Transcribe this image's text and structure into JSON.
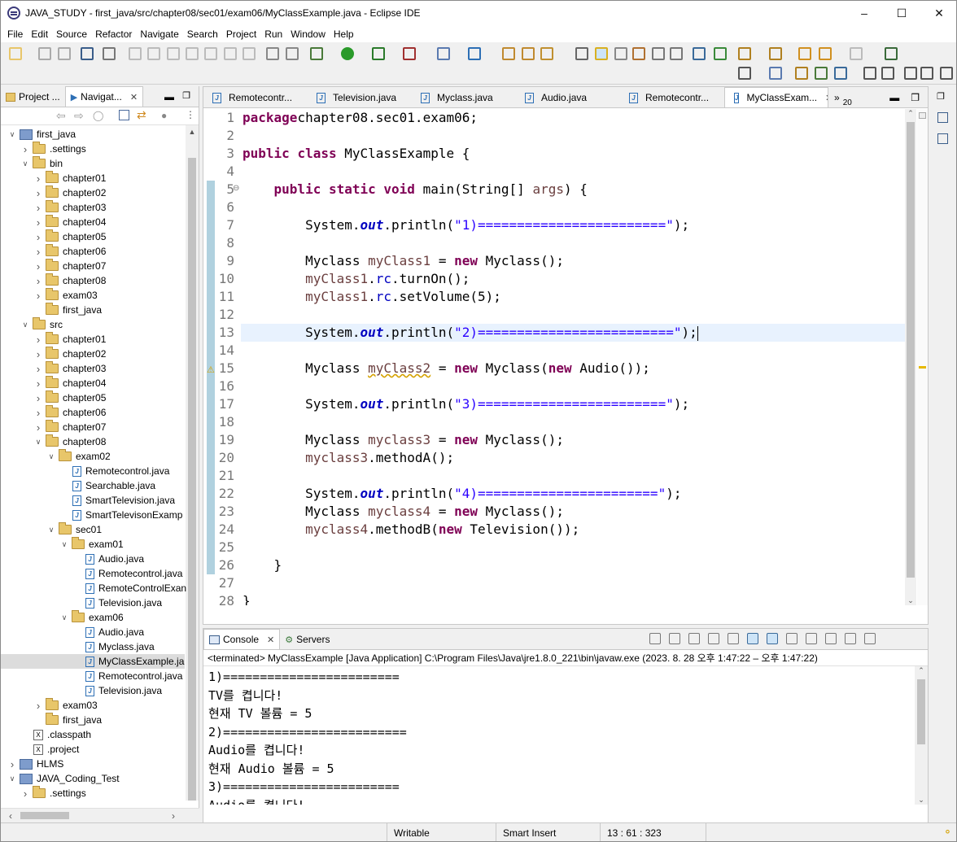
{
  "window": {
    "title": "JAVA_STUDY - first_java/src/chapter08/sec01/exam06/MyClassExample.java - Eclipse IDE"
  },
  "menu": [
    "File",
    "Edit",
    "Source",
    "Refactor",
    "Navigate",
    "Search",
    "Project",
    "Run",
    "Window",
    "Help"
  ],
  "left_panel": {
    "tabs": [
      {
        "label": "Project ..."
      },
      {
        "label": "Navigat..."
      }
    ],
    "tree": [
      {
        "label": "first_java",
        "depth": 0,
        "type": "project",
        "open": true
      },
      {
        "label": ".settings",
        "depth": 1,
        "type": "folder",
        "open": false
      },
      {
        "label": "bin",
        "depth": 1,
        "type": "folder",
        "open": true
      },
      {
        "label": "chapter01",
        "depth": 2,
        "type": "folder",
        "open": false
      },
      {
        "label": "chapter02",
        "depth": 2,
        "type": "folder",
        "open": false
      },
      {
        "label": "chapter03",
        "depth": 2,
        "type": "folder",
        "open": false
      },
      {
        "label": "chapter04",
        "depth": 2,
        "type": "folder",
        "open": false
      },
      {
        "label": "chapter05",
        "depth": 2,
        "type": "folder",
        "open": false
      },
      {
        "label": "chapter06",
        "depth": 2,
        "type": "folder",
        "open": false
      },
      {
        "label": "chapter07",
        "depth": 2,
        "type": "folder",
        "open": false
      },
      {
        "label": "chapter08",
        "depth": 2,
        "type": "folder",
        "open": false
      },
      {
        "label": "exam03",
        "depth": 2,
        "type": "folder",
        "open": false
      },
      {
        "label": "first_java",
        "depth": 2,
        "type": "folder",
        "open": null
      },
      {
        "label": "src",
        "depth": 1,
        "type": "folder",
        "open": true
      },
      {
        "label": "chapter01",
        "depth": 2,
        "type": "folder",
        "open": false
      },
      {
        "label": "chapter02",
        "depth": 2,
        "type": "folder",
        "open": false
      },
      {
        "label": "chapter03",
        "depth": 2,
        "type": "folder",
        "open": false
      },
      {
        "label": "chapter04",
        "depth": 2,
        "type": "folder",
        "open": false
      },
      {
        "label": "chapter05",
        "depth": 2,
        "type": "folder",
        "open": false
      },
      {
        "label": "chapter06",
        "depth": 2,
        "type": "folder",
        "open": false
      },
      {
        "label": "chapter07",
        "depth": 2,
        "type": "folder",
        "open": false
      },
      {
        "label": "chapter08",
        "depth": 2,
        "type": "folder",
        "open": true
      },
      {
        "label": "exam02",
        "depth": 3,
        "type": "folder",
        "open": true
      },
      {
        "label": "Remotecontrol.java",
        "depth": 4,
        "type": "java"
      },
      {
        "label": "Searchable.java",
        "depth": 4,
        "type": "java"
      },
      {
        "label": "SmartTelevision.java",
        "depth": 4,
        "type": "java"
      },
      {
        "label": "SmartTelevisonExamp",
        "depth": 4,
        "type": "java"
      },
      {
        "label": "sec01",
        "depth": 3,
        "type": "folder",
        "open": true
      },
      {
        "label": "exam01",
        "depth": 4,
        "type": "folder",
        "open": true
      },
      {
        "label": "Audio.java",
        "depth": 5,
        "type": "java"
      },
      {
        "label": "Remotecontrol.java",
        "depth": 5,
        "type": "java"
      },
      {
        "label": "RemoteControlExan",
        "depth": 5,
        "type": "java"
      },
      {
        "label": "Television.java",
        "depth": 5,
        "type": "java"
      },
      {
        "label": "exam06",
        "depth": 4,
        "type": "folder",
        "open": true
      },
      {
        "label": "Audio.java",
        "depth": 5,
        "type": "java"
      },
      {
        "label": "Myclass.java",
        "depth": 5,
        "type": "java"
      },
      {
        "label": "MyClassExample.ja",
        "depth": 5,
        "type": "java",
        "selected": true
      },
      {
        "label": "Remotecontrol.java",
        "depth": 5,
        "type": "java"
      },
      {
        "label": "Television.java",
        "depth": 5,
        "type": "java"
      },
      {
        "label": "exam03",
        "depth": 2,
        "type": "folder",
        "open": false
      },
      {
        "label": "first_java",
        "depth": 2,
        "type": "folder",
        "open": null
      },
      {
        "label": ".classpath",
        "depth": 1,
        "type": "xml"
      },
      {
        "label": ".project",
        "depth": 1,
        "type": "xml"
      },
      {
        "label": "HLMS",
        "depth": 0,
        "type": "project",
        "open": false
      },
      {
        "label": "JAVA_Coding_Test",
        "depth": 0,
        "type": "project",
        "open": true
      },
      {
        "label": ".settings",
        "depth": 1,
        "type": "folder",
        "open": false
      }
    ]
  },
  "editor": {
    "tabs": [
      {
        "label": "Remotecontr...",
        "active": false
      },
      {
        "label": "Television.java",
        "active": false
      },
      {
        "label": "Myclass.java",
        "active": false
      },
      {
        "label": "Audio.java",
        "active": false
      },
      {
        "label": "Remotecontr...",
        "active": false
      },
      {
        "label": "MyClassExam...",
        "active": true
      }
    ],
    "overflow": "»",
    "overflow_count": "20",
    "lines": [
      [
        [
          "kw",
          "package"
        ],
        [
          "",
          "chapter08.sec01.exam06;"
        ]
      ],
      [],
      [
        [
          "kw",
          "public"
        ],
        [
          "",
          " "
        ],
        [
          "kw",
          "class"
        ],
        [
          "",
          " MyClassExample {"
        ]
      ],
      [],
      [
        [
          "",
          "    "
        ],
        [
          "kw",
          "public"
        ],
        [
          "",
          " "
        ],
        [
          "kw",
          "static"
        ],
        [
          "",
          " "
        ],
        [
          "kw",
          "void"
        ],
        [
          "",
          " main(String[] "
        ],
        [
          "va",
          "args"
        ],
        [
          "",
          ") {"
        ]
      ],
      [],
      [
        [
          "",
          "        System."
        ],
        [
          "fl",
          "out"
        ],
        [
          "",
          ".println("
        ],
        [
          "st",
          "\"1)========================\""
        ],
        [
          "",
          ");"
        ]
      ],
      [],
      [
        [
          "",
          "        Myclass "
        ],
        [
          "va",
          "myClass1"
        ],
        [
          "",
          " = "
        ],
        [
          "kw",
          "new"
        ],
        [
          "",
          " Myclass();"
        ]
      ],
      [
        [
          "",
          "        "
        ],
        [
          "va",
          "myClass1"
        ],
        [
          "",
          "."
        ],
        [
          "fi",
          "rc"
        ],
        [
          "",
          ".turnOn();"
        ]
      ],
      [
        [
          "",
          "        "
        ],
        [
          "va",
          "myClass1"
        ],
        [
          "",
          "."
        ],
        [
          "fi",
          "rc"
        ],
        [
          "",
          ".setVolume(5);"
        ]
      ],
      [],
      [
        [
          "",
          "        System."
        ],
        [
          "fl",
          "out"
        ],
        [
          "",
          ".println("
        ],
        [
          "st",
          "\"2)=========================\""
        ],
        [
          "",
          ");"
        ]
      ],
      [],
      [
        [
          "",
          "        Myclass "
        ],
        [
          "va",
          "myClass2"
        ],
        [
          "",
          " = "
        ],
        [
          "kw",
          "new"
        ],
        [
          "",
          " Myclass("
        ],
        [
          "kw",
          "new"
        ],
        [
          "",
          " Audio());"
        ]
      ],
      [],
      [
        [
          "",
          "        System."
        ],
        [
          "fl",
          "out"
        ],
        [
          "",
          ".println("
        ],
        [
          "st",
          "\"3)========================\""
        ],
        [
          "",
          ");"
        ]
      ],
      [],
      [
        [
          "",
          "        Myclass "
        ],
        [
          "va",
          "myclass3"
        ],
        [
          "",
          " = "
        ],
        [
          "kw",
          "new"
        ],
        [
          "",
          " Myclass();"
        ]
      ],
      [
        [
          "",
          "        "
        ],
        [
          "va",
          "myclass3"
        ],
        [
          "",
          ".methodA();"
        ]
      ],
      [],
      [
        [
          "",
          "        System."
        ],
        [
          "fl",
          "out"
        ],
        [
          "",
          ".println("
        ],
        [
          "st",
          "\"4)=======================\""
        ],
        [
          "",
          ");"
        ]
      ],
      [
        [
          "",
          "        Myclass "
        ],
        [
          "va",
          "myclass4"
        ],
        [
          "",
          " = "
        ],
        [
          "kw",
          "new"
        ],
        [
          "",
          " Myclass();"
        ]
      ],
      [
        [
          "",
          "        "
        ],
        [
          "va",
          "myclass4"
        ],
        [
          "",
          ".methodB("
        ],
        [
          "kw",
          "new"
        ],
        [
          "",
          " Television());"
        ]
      ],
      [],
      [
        [
          "",
          "    }"
        ]
      ],
      [],
      [
        [
          "",
          "}"
        ]
      ]
    ],
    "current_line": 13
  },
  "console": {
    "tabs": [
      {
        "label": "Console"
      },
      {
        "label": "Servers"
      }
    ],
    "terminated": "<terminated> MyClassExample [Java Application] C:\\Program Files\\Java\\jre1.8.0_221\\bin\\javaw.exe  (2023. 8. 28 오후 1:47:22 – 오후 1:47:22)",
    "output": [
      "1)========================",
      "TV를 켭니다!",
      "현재 TV 볼륨 = 5",
      "2)=========================",
      "Audio를 켭니다!",
      "현재 Audio 볼륨 = 5",
      "3)========================",
      "Audio를 켭니다!"
    ]
  },
  "status": {
    "writable": "Writable",
    "insert": "Smart Insert",
    "position": "13 : 61 : 323"
  }
}
